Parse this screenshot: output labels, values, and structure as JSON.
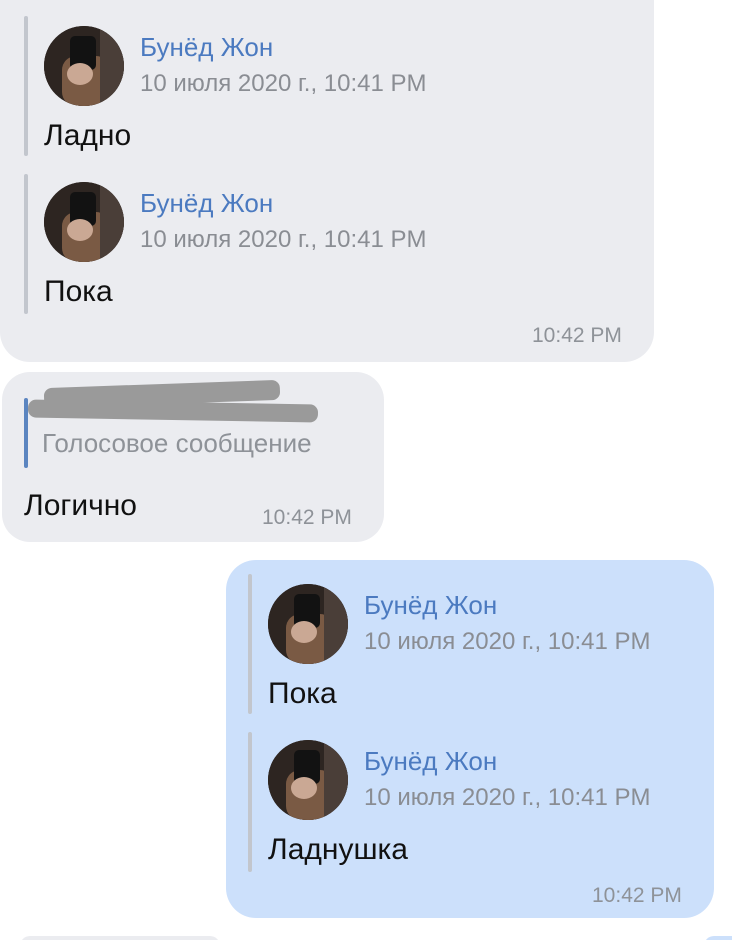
{
  "messages": [
    {
      "direction": "incoming",
      "forwarded": [
        {
          "author": "Бунёд Жон",
          "date": "10 июля 2020 г., 10:41 PM",
          "text": "Ладно"
        },
        {
          "author": "Бунёд Жон",
          "date": "10 июля 2020 г., 10:41 PM",
          "text": "Пока"
        }
      ],
      "time": "10:42 PM"
    },
    {
      "direction": "incoming",
      "reply": {
        "preview": "Голосовое сообщение"
      },
      "text": "Логично",
      "time": "10:42 PM"
    },
    {
      "direction": "outgoing",
      "forwarded": [
        {
          "author": "Бунёд Жон",
          "date": "10 июля 2020 г., 10:41 PM",
          "text": "Пока"
        },
        {
          "author": "Бунёд Жон",
          "date": "10 июля 2020 г., 10:41 PM",
          "text": "Ладнушка"
        }
      ],
      "time": "10:42 PM"
    }
  ],
  "colors": {
    "incoming_bubble": "#ebecf0",
    "outgoing_bubble": "#cce0fb",
    "author_name": "#4b7ac0",
    "meta_text": "#8e9298"
  },
  "icons": {
    "avatar": "avatar-photo"
  }
}
